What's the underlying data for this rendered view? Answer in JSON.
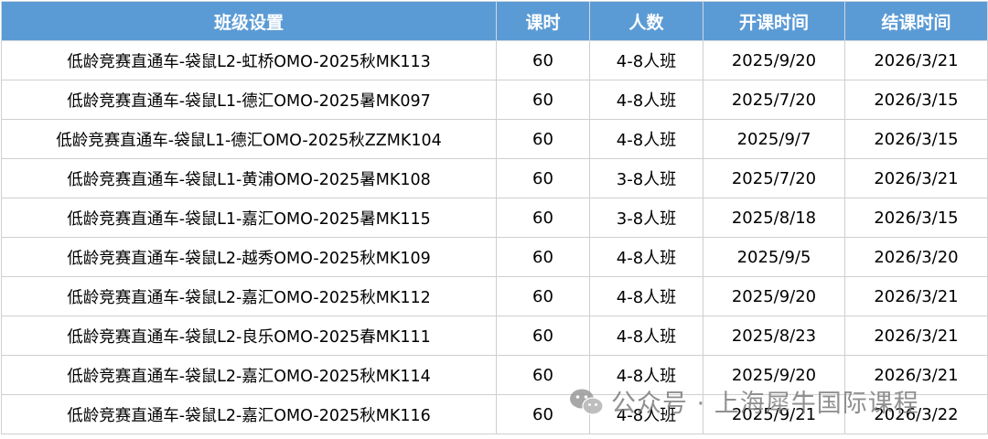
{
  "table": {
    "headers": {
      "name": "班级设置",
      "hours": "课时",
      "size": "人数",
      "start": "开课时间",
      "end": "结课时间"
    },
    "rows": [
      {
        "name": "低龄竞赛直通车-袋鼠L2-虹桥OMO-2025秋MK113",
        "hours": "60",
        "size": "4-8人班",
        "start": "2025/9/20",
        "end": "2026/3/21"
      },
      {
        "name": "低龄竞赛直通车-袋鼠L1-德汇OMO-2025暑MK097",
        "hours": "60",
        "size": "4-8人班",
        "start": "2025/7/20",
        "end": "2026/3/15"
      },
      {
        "name": "低龄竞赛直通车-袋鼠L1-德汇OMO-2025秋ZZMK104",
        "hours": "60",
        "size": "4-8人班",
        "start": "2025/9/7",
        "end": "2026/3/15"
      },
      {
        "name": "低龄竞赛直通车-袋鼠L1-黄浦OMO-2025暑MK108",
        "hours": "60",
        "size": "3-8人班",
        "start": "2025/7/20",
        "end": "2026/3/21"
      },
      {
        "name": "低龄竞赛直通车-袋鼠L1-嘉汇OMO-2025暑MK115",
        "hours": "60",
        "size": "3-8人班",
        "start": "2025/8/18",
        "end": "2026/3/15"
      },
      {
        "name": "低龄竞赛直通车-袋鼠L2-越秀OMO-2025秋MK109",
        "hours": "60",
        "size": "4-8人班",
        "start": "2025/9/5",
        "end": "2026/3/20"
      },
      {
        "name": "低龄竞赛直通车-袋鼠L2-嘉汇OMO-2025秋MK112",
        "hours": "60",
        "size": "4-8人班",
        "start": "2025/9/20",
        "end": "2026/3/21"
      },
      {
        "name": "低龄竞赛直通车-袋鼠L2-良乐OMO-2025春MK111",
        "hours": "60",
        "size": "4-8人班",
        "start": "2025/8/23",
        "end": "2026/3/21"
      },
      {
        "name": "低龄竞赛直通车-袋鼠L2-嘉汇OMO-2025秋MK114",
        "hours": "60",
        "size": "4-8人班",
        "start": "2025/9/20",
        "end": "2026/3/21"
      },
      {
        "name": "低龄竞赛直通车-袋鼠L2-嘉汇OMO-2025秋MK116",
        "hours": "60",
        "size": "4-8人班",
        "start": "2025/9/21",
        "end": "2026/3/22"
      }
    ]
  },
  "watermark": {
    "icon": "wechat-icon",
    "text": "公众号 · 上海犀牛国际课程"
  },
  "colors": {
    "header_bg": "#5b9bd5",
    "header_text": "#ffffff",
    "grid": "#cfcfcf"
  }
}
